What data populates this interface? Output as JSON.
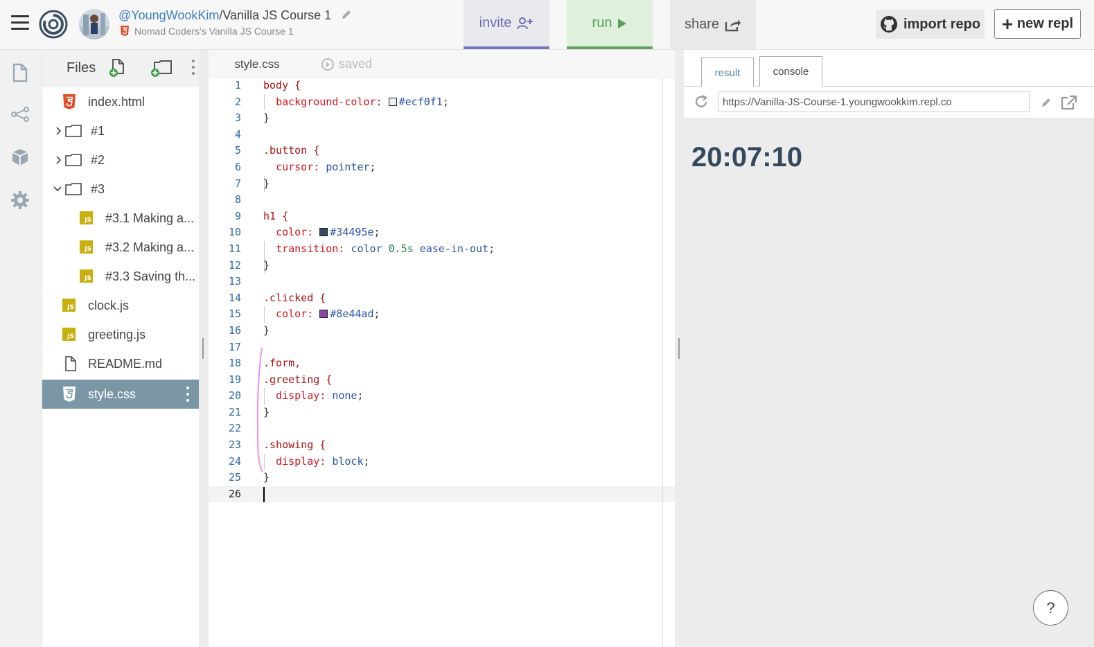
{
  "header": {
    "username": "@YoungWookKim",
    "separator": "/",
    "repl_name": "Vanilla JS Course 1",
    "subtitle": "Nomad Coders's Vanilla JS Course 1",
    "invite_label": "invite",
    "run_label": "run",
    "share_label": "share",
    "import_label": "import repo",
    "new_label": "new repl"
  },
  "files": {
    "title": "Files",
    "items": [
      {
        "label": "index.html"
      },
      {
        "label": "#1"
      },
      {
        "label": "#2"
      },
      {
        "label": "#3"
      },
      {
        "label": "#3.1 Making a..."
      },
      {
        "label": "#3.2 Making a..."
      },
      {
        "label": "#3.3 Saving th..."
      },
      {
        "label": "clock.js"
      },
      {
        "label": "greeting.js"
      },
      {
        "label": "README.md"
      },
      {
        "label": "style.css"
      }
    ],
    "js_badge": "JS"
  },
  "editor": {
    "tab_label": "style.css",
    "status": "saved",
    "line_numbers": [
      "1",
      "2",
      "3",
      "4",
      "5",
      "6",
      "7",
      "8",
      "9",
      "10",
      "11",
      "12",
      "13",
      "14",
      "15",
      "16",
      "17",
      "18",
      "19",
      "20",
      "21",
      "22",
      "23",
      "24",
      "25",
      "26"
    ],
    "code": {
      "l1": "body {",
      "l2_prop": "background-color: ",
      "l2_val": "#ecf0f1",
      "l3": "}",
      "l5": ".button {",
      "l6_prop": "cursor: ",
      "l6_val": "pointer",
      "l7": "}",
      "l9": "h1 {",
      "l10_prop": "color: ",
      "l10_val": "#34495e",
      "l11_prop": "transition: ",
      "l11_val1": "color ",
      "l11_num": "0.5s",
      "l11_val2": " ease-in-out",
      "l12": "}",
      "l14": ".clicked {",
      "l15_prop": "color: ",
      "l15_val": "#8e44ad",
      "l16": "}",
      "l18": ".form,",
      "l19": ".greeting {",
      "l20_prop": "display: ",
      "l20_val": "none",
      "l21": "}",
      "l23": ".showing {",
      "l24_prop": "display: ",
      "l24_val": "block",
      "l25": "}"
    },
    "swatches": {
      "l2": "#ecf0f1",
      "l10": "#34495e",
      "l15": "#8e44ad"
    }
  },
  "preview": {
    "tab_result": "result",
    "tab_console": "console",
    "url": "https://Vanilla-JS-Course-1.youngwookkim.repl.co",
    "clock_text": "20:07:10",
    "help_label": "?"
  },
  "colors": {
    "accent_invite": "#7078c2",
    "accent_run": "#5da25d",
    "active_file": "#7b97a6",
    "clock": "#34495e",
    "annotation": "#f08ef0"
  }
}
